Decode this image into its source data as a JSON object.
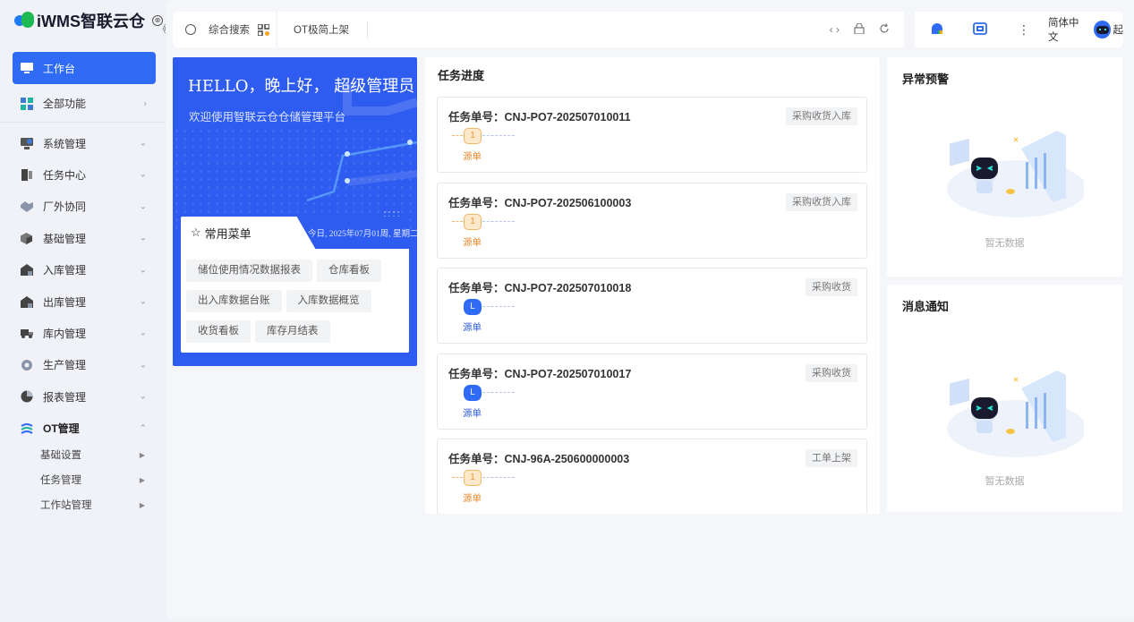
{
  "app": {
    "brand": "iWMS智联云仓"
  },
  "sidebar": {
    "items": [
      {
        "label": "工作台",
        "icon": "monitor-icon",
        "active": true
      },
      {
        "label": "全部功能",
        "icon": "grid-icon",
        "chevron": "›"
      },
      {
        "label": "系统管理",
        "icon": "settings-monitor-icon",
        "chevron": "⌄"
      },
      {
        "label": "任务中心",
        "icon": "task-icon",
        "chevron": "⌄"
      },
      {
        "label": "厂外协同",
        "icon": "handshake-icon",
        "chevron": "⌄"
      },
      {
        "label": "基础管理",
        "icon": "cube-icon",
        "chevron": "⌄"
      },
      {
        "label": "入库管理",
        "icon": "warehouse-in-icon",
        "chevron": "⌄"
      },
      {
        "label": "出库管理",
        "icon": "warehouse-out-icon",
        "chevron": "⌄"
      },
      {
        "label": "库内管理",
        "icon": "truck-icon",
        "chevron": "⌄"
      },
      {
        "label": "生产管理",
        "icon": "gear-icon",
        "chevron": "⌄"
      },
      {
        "label": "报表管理",
        "icon": "pie-chart-icon",
        "chevron": "⌄"
      },
      {
        "label": "OT管理",
        "icon": "ot-icon",
        "chevron": "⌃"
      }
    ],
    "subitems": [
      {
        "label": "基础设置"
      },
      {
        "label": "任务管理"
      },
      {
        "label": "工作站管理"
      }
    ]
  },
  "topbar": {
    "search_label": "综合搜索",
    "tabs": [
      {
        "label": "OT极简上架"
      }
    ],
    "language": "简体中文",
    "user_initial": "起"
  },
  "welcome": {
    "greeting": "HELLO，晚上好， 超级管理员",
    "subtitle": "欢迎使用智联云仓仓储管理平台",
    "menu_title": "常用菜单",
    "date": "今日, 2025年07月01周, 星期二",
    "chips": [
      "储位使用情况数据报表",
      "仓库看板",
      "出入库数据台账",
      "入库数据概览",
      "收货看板",
      "库存月结表"
    ]
  },
  "tasks": {
    "title": "任务进度",
    "items": [
      {
        "id": "任务单号：CNJ-PO7-202507010011",
        "tag": "采购收货入库",
        "step": "1",
        "step_label": "源单",
        "state": "pending"
      },
      {
        "id": "任务单号：CNJ-PO7-202506100003",
        "tag": "采购收货入库",
        "step": "1",
        "step_label": "源单",
        "state": "pending"
      },
      {
        "id": "任务单号：CNJ-PO7-202507010018",
        "tag": "采购收货",
        "step": "L",
        "step_label": "源单",
        "state": "active"
      },
      {
        "id": "任务单号：CNJ-PO7-202507010017",
        "tag": "采购收货",
        "step": "L",
        "step_label": "源单",
        "state": "active"
      },
      {
        "id": "任务单号：CNJ-96A-250600000003",
        "tag": "工单上架",
        "step": "1",
        "step_label": "源单",
        "state": "pending"
      }
    ]
  },
  "alerts": {
    "title": "异常预警",
    "empty": "暂无数据"
  },
  "notices": {
    "title": "消息通知",
    "empty": "暂无数据"
  },
  "colors": {
    "accent": "#2f6bf5",
    "welcome_bg": "#2e5bf0",
    "pending": "#e7963a"
  }
}
